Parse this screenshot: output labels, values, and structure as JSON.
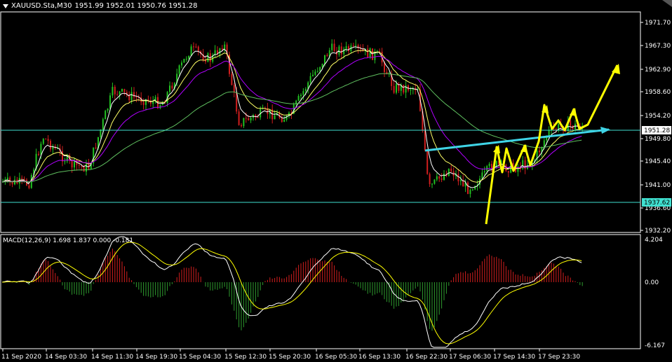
{
  "header": {
    "symbol": "XAUUSD.Sta,M30",
    "ohlc": "1951.99 1952.01 1950.76 1951.28"
  },
  "macd": {
    "label": "MACD(12,26,9) 1.698 1.837 0.000 -0.181",
    "ticks": [
      "4.204",
      "0.00",
      "-6.167"
    ]
  },
  "price_axis": {
    "ticks": [
      "1971.70",
      "1967.30",
      "1962.90",
      "1958.60",
      "1954.20",
      "1949.80",
      "1945.40",
      "1941.00",
      "1936.60",
      "1932.20"
    ],
    "current": "1951.28",
    "level": "1937.62"
  },
  "time_axis": [
    "11 Sep 2020",
    "14 Sep 03:30",
    "14 Sep 11:30",
    "14 Sep 19:30",
    "15 Sep 04:30",
    "15 Sep 12:30",
    "15 Sep 20:30",
    "16 Sep 05:30",
    "16 Sep 13:30",
    "16 Sep 22:30",
    "17 Sep 06:30",
    "17 Sep 14:30",
    "17 Sep 23:30"
  ],
  "colors": {
    "bull": "#22c322",
    "bear": "#d21e1e",
    "hline": "#40e0d0",
    "projection": "#ffff00",
    "trendline": "#3fd4e6"
  }
}
